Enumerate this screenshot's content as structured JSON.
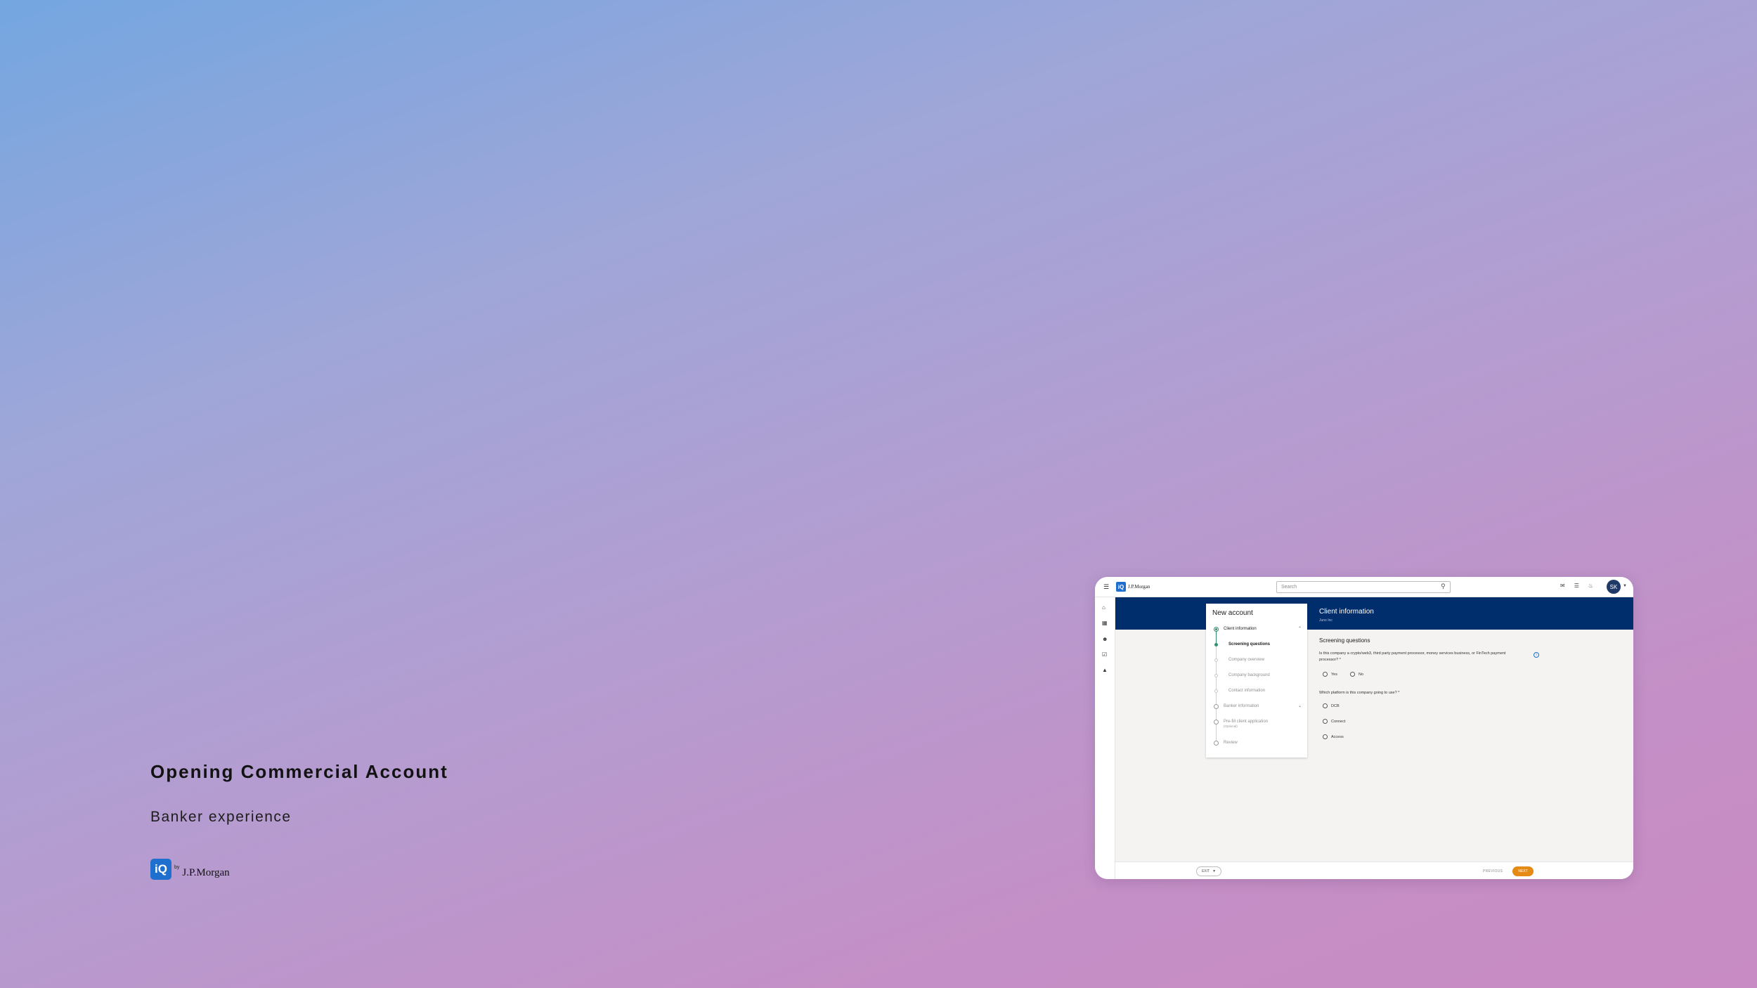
{
  "hero": {
    "title": "Opening Commercial Account",
    "subtitle": "Banker experience",
    "logo_mark": "iQ",
    "logo_by": "by",
    "logo_brand": "J.P.Morgan"
  },
  "app": {
    "topbar": {
      "menu_icon": "hamburger-icon",
      "logo_mark": "iQ",
      "logo_brand": "J.P.Morgan",
      "search_placeholder": "Search",
      "icons": [
        "chat-icon",
        "mail-icon",
        "bell-icon"
      ],
      "avatar_initials": "SK"
    },
    "sidenav_icons": [
      "home-icon",
      "accounts-icon",
      "users-icon",
      "tasks-icon",
      "learning-icon"
    ],
    "banner": {
      "title": "Client information",
      "subtitle": "Juno Inc"
    },
    "steps": {
      "title": "New account",
      "items": [
        {
          "label": "Client information",
          "level": 0,
          "state": "active",
          "expanded": true
        },
        {
          "label": "Screening questions",
          "level": 1,
          "state": "current"
        },
        {
          "label": "Company overview",
          "level": 1,
          "state": "pending"
        },
        {
          "label": "Company background",
          "level": 1,
          "state": "pending"
        },
        {
          "label": "Contact information",
          "level": 1,
          "state": "pending"
        },
        {
          "label": "Banker information",
          "level": 0,
          "state": "pending",
          "expanded": false
        },
        {
          "label": "Pre-fill client application",
          "level": 0,
          "state": "pending",
          "note": "(Optional)"
        },
        {
          "label": "Review",
          "level": 0,
          "state": "pending"
        }
      ]
    },
    "form": {
      "heading": "Screening questions",
      "question1": "Is this company a crypto/web3, third party payment processor, money services business, or FinTech payment processor? *",
      "question1_options": [
        "Yes",
        "No"
      ],
      "question2": "Which platform is this company going to use? *",
      "question2_options": [
        "DCB",
        "Connect",
        "Access"
      ]
    },
    "footer": {
      "exit_label": "EXIT",
      "previous_label": "PREVIOUS",
      "next_label": "NEXT"
    },
    "colors": {
      "banner": "#002d6c",
      "accent_green": "#2e8b6a",
      "next_button": "#e58a14",
      "brand_blue": "#1e6fce"
    }
  }
}
